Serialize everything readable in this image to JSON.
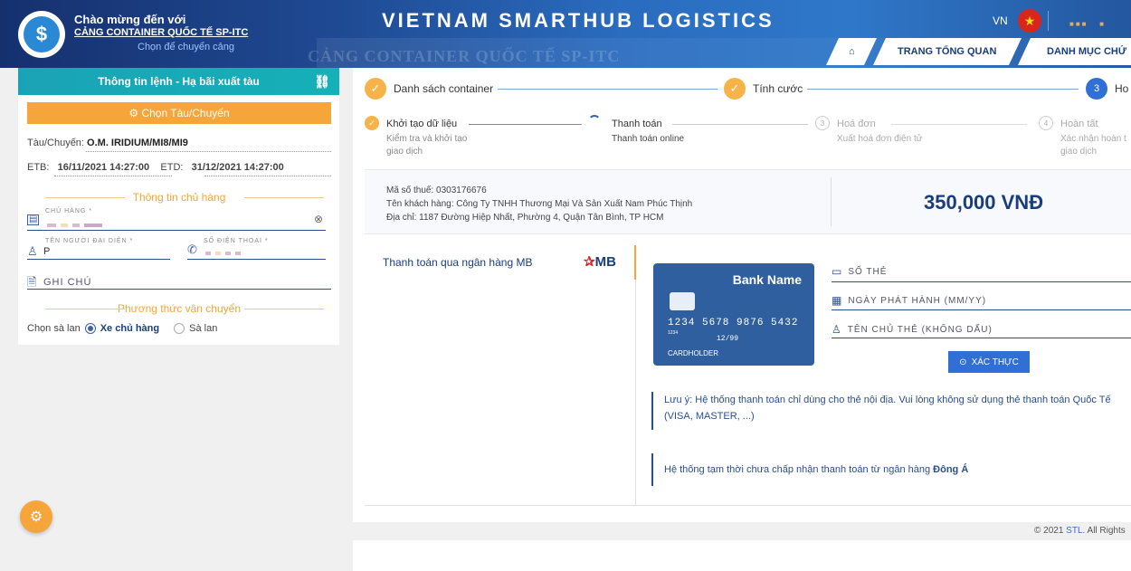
{
  "header": {
    "welcome": "Chào mừng đến với",
    "port_name": "CẢNG CONTAINER QUỐC TẾ SP-ITC",
    "choose_port": "Chọn để chuyển cảng",
    "brand": "VIETNAM SMARTHUB LOGISTICS",
    "watermark": "CẢNG CONTAINER QUỐC TẾ SP-ITC",
    "lang": "VN",
    "nav": {
      "home_icon": "home-icon",
      "overview": "TRANG TỔNG QUAN",
      "category": "DANH MỤC CHỨ"
    }
  },
  "left": {
    "title": "Thông tin lệnh - Hạ bãi xuất tàu",
    "choose_ship_btn": "Chọn Tàu/Chuyến",
    "ship_label": "Tàu/Chuyến:",
    "ship_value": "O.M. IRIDIUM/MI8/MI9",
    "etb_label": "ETB:",
    "etb_value": "16/11/2021 14:27:00",
    "etd_label": "ETD:",
    "etd_value": "31/12/2021 14:27:00",
    "owner_section": "Thông tin chủ hàng",
    "owner_label": "CHỦ HÀNG *",
    "rep_label": "TÊN NGƯỜI ĐẠI DIỆN *",
    "rep_value": "P",
    "phone_label": "SỐ ĐIỆN THOẠI *",
    "note_label": "GHI CHÚ",
    "transport_section": "Phương thức vận chuyển",
    "barge_choice_label": "Chọn sà lan",
    "opt_truck": "Xe chủ hàng",
    "opt_barge": "Sà lan"
  },
  "steps": {
    "s1": "Danh sách container",
    "s2": "Tính cước",
    "s3_num": "3",
    "s3": "Ho",
    "sub": [
      {
        "title": "Khởi tạo dữ liệu",
        "desc1": "Kiểm tra và khởi tạo",
        "desc2": "giao dịch"
      },
      {
        "title": "Thanh toán",
        "desc1": "Thanh toán online",
        "desc2": ""
      },
      {
        "num": "3",
        "title": "Hoá đơn",
        "desc1": "Xuất hoá đơn điện tử",
        "desc2": ""
      },
      {
        "num": "4",
        "title": "Hoàn tất",
        "desc1": "Xác nhận hoàn t",
        "desc2": "giao dịch"
      }
    ]
  },
  "invoice": {
    "tax_code": "Mã số thuế: 0303176676",
    "customer": "Tên khách hàng: Công Ty TNHH Thương Mại Và Sản Xuất Nam Phúc Thịnh",
    "address": "Địa chỉ: 1187 Đường Hiệp Nhất, Phường 4, Quận Tân Bình, TP HCM",
    "amount": "350,000 VNĐ"
  },
  "payment": {
    "bank_option": "Thanh toán qua ngân hàng MB",
    "bank_logo": "MB",
    "card": {
      "bank_name": "Bank Name",
      "number": "1234 5678 9876 5432",
      "small": "1234",
      "exp": "12/99",
      "holder": "CARDHOLDER"
    },
    "card_number_label": "SỐ THẺ",
    "issue_date_label": "NGÀY PHÁT HÀNH (MM/YY)",
    "holder_label": "TÊN CHỦ THẺ (KHÔNG DẤU)",
    "verify_btn": "XÁC THỰC",
    "note1": "Lưu ý: Hệ thống thanh toán chỉ dùng cho thẻ nội địa. Vui lòng không sử dụng thẻ thanh toán Quốc Tế (VISA, MASTER, ...)",
    "note2_prefix": "Hệ thống tạm thời chưa chấp nhận thanh toán từ ngân hàng ",
    "note2_bank": "Đông Á"
  },
  "footer": {
    "prefix": "© 2021 ",
    "brand": "STL",
    "suffix": ". All Rights"
  },
  "colors": {
    "accent": "#f5a53a",
    "primary": "#1a3d7c",
    "teal": "#1aa3b5",
    "blue": "#2f6fd6"
  }
}
